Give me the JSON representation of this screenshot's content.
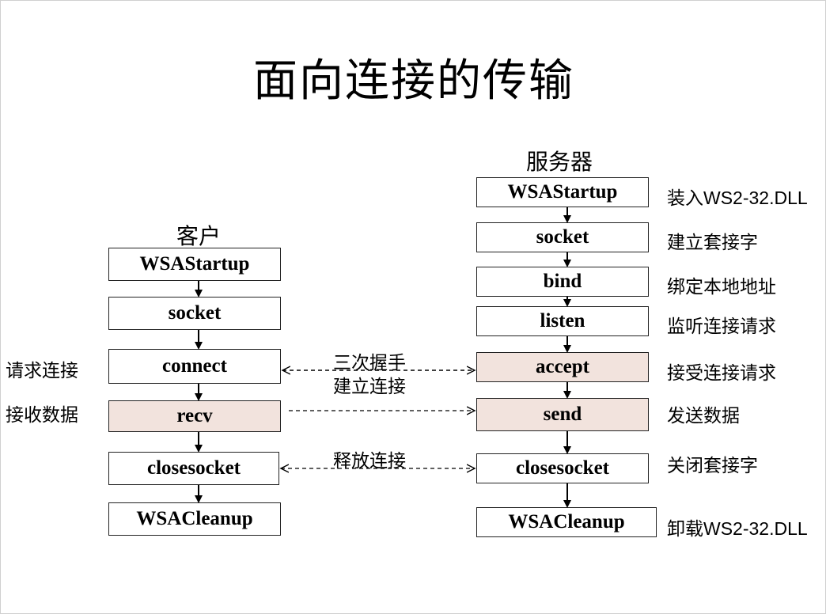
{
  "title": "面向连接的传输",
  "client": {
    "heading": "客户",
    "steps": [
      "WSAStartup",
      "socket",
      "connect",
      "recv",
      "closesocket",
      "WSACleanup"
    ]
  },
  "server": {
    "heading": "服务器",
    "steps": [
      "WSAStartup",
      "socket",
      "bind",
      "listen",
      "accept",
      "send",
      "closesocket",
      "WSACleanup"
    ]
  },
  "client_notes": {
    "connect": "请求连接",
    "recv": "接收数据"
  },
  "server_notes": {
    "startup_prefix": "装入",
    "startup_dll": "WS2-32.DLL",
    "socket": "建立套接字",
    "bind": "绑定本地地址",
    "listen": "监听连接请求",
    "accept": "接受连接请求",
    "send": "发送数据",
    "closesocket": "关闭套接字",
    "cleanup_prefix": "卸载",
    "cleanup_dll": "WS2-32.DLL"
  },
  "links": {
    "handshake_line1": "三次握手",
    "handshake_line2": "建立连接",
    "release": "释放连接"
  },
  "colors": {
    "highlight": "#f2e3dd",
    "border": "#222222"
  }
}
